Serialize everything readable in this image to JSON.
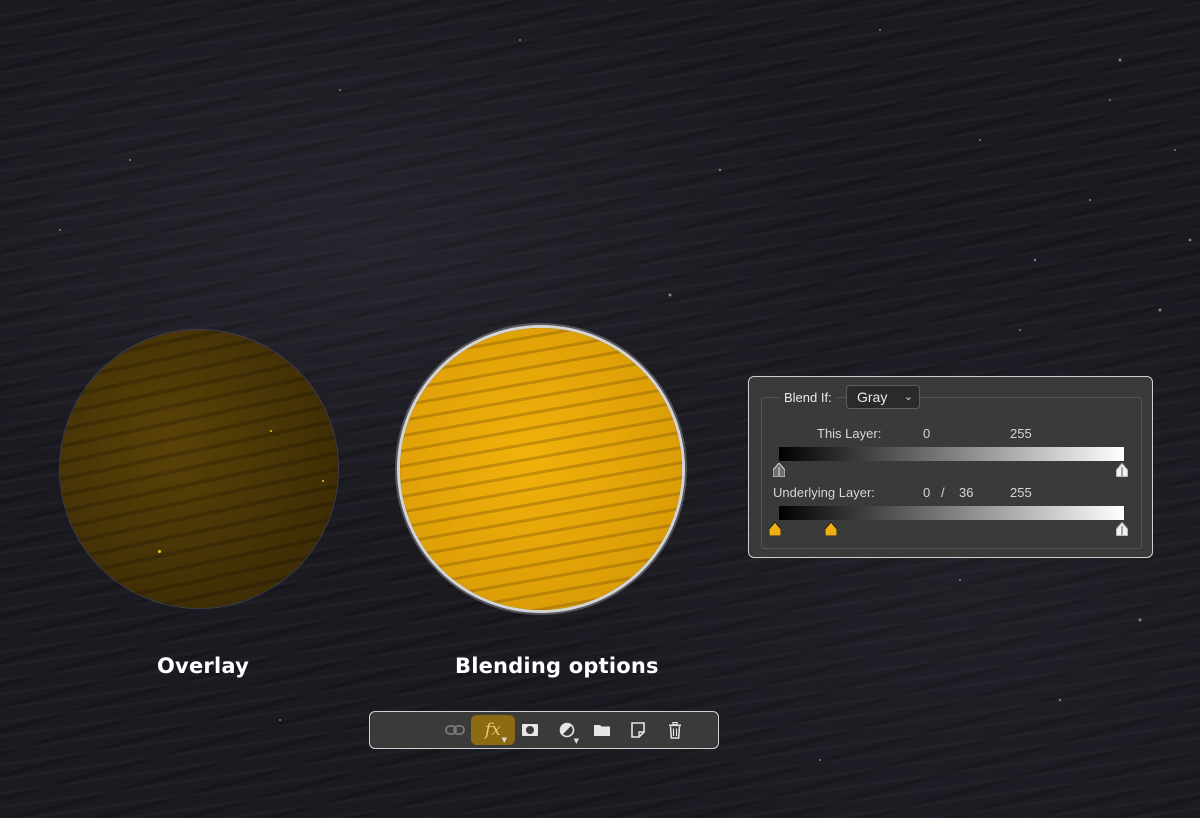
{
  "captions": {
    "overlay": "Overlay",
    "blending_options": "Blending options"
  },
  "blend_if_panel": {
    "label": "Blend If:",
    "channel_select": {
      "value": "Gray"
    },
    "this_layer": {
      "label": "This Layer:",
      "black_value": "0",
      "white_value": "255"
    },
    "underlying_layer": {
      "label": "Underlying Layer:",
      "black_value": "0",
      "separator": "/",
      "black_split_value": "36",
      "white_value": "255"
    }
  },
  "layers_toolbar": {
    "buttons": [
      {
        "icon": "link-icon",
        "state": "disabled"
      },
      {
        "icon": "fx-icon",
        "text": "fx",
        "state": "active"
      },
      {
        "icon": "layer-mask-icon"
      },
      {
        "icon": "adjustment-layer-icon"
      },
      {
        "icon": "folder-icon"
      },
      {
        "icon": "new-layer-icon"
      },
      {
        "icon": "trash-icon"
      }
    ]
  },
  "colors": {
    "accent_gold": "#f1b20c",
    "fx_active_bg": "#8c6a12",
    "panel_bg": "#3a3a3a"
  }
}
